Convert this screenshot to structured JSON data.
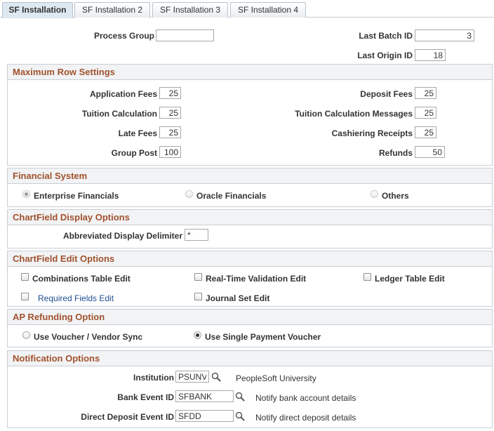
{
  "tabs": [
    {
      "label": "SF Installation",
      "active": true
    },
    {
      "label": "SF Installation 2",
      "active": false
    },
    {
      "label": "SF Installation 3",
      "active": false
    },
    {
      "label": "SF Installation 4",
      "active": false
    }
  ],
  "header": {
    "process_group_label": "Process Group",
    "process_group_value": "",
    "last_batch_id_label": "Last Batch ID",
    "last_batch_id_value": "3",
    "last_origin_id_label": "Last Origin ID",
    "last_origin_id_value": "18"
  },
  "max_row": {
    "title": "Maximum Row Settings",
    "application_fees_label": "Application Fees",
    "application_fees_value": "25",
    "tuition_calc_label": "Tuition Calculation",
    "tuition_calc_value": "25",
    "late_fees_label": "Late Fees",
    "late_fees_value": "25",
    "group_post_label": "Group Post",
    "group_post_value": "100",
    "deposit_fees_label": "Deposit Fees",
    "deposit_fees_value": "25",
    "tuition_calc_msgs_label": "Tuition Calculation Messages",
    "tuition_calc_msgs_value": "25",
    "cashiering_receipts_label": "Cashiering Receipts",
    "cashiering_receipts_value": "25",
    "refunds_label": "Refunds",
    "refunds_value": "50"
  },
  "financial_system": {
    "title": "Financial System",
    "options": [
      "Enterprise Financials",
      "Oracle Financials",
      "Others"
    ],
    "selected": "Enterprise Financials"
  },
  "chartfield_display": {
    "title": "ChartField Display Options",
    "delimiter_label": "Abbreviated Display Delimiter",
    "delimiter_value": "*"
  },
  "chartfield_edit": {
    "title": "ChartField Edit Options",
    "combinations_label": "Combinations Table Edit",
    "realtime_label": "Real-Time Validation Edit",
    "ledger_label": "Ledger Table Edit",
    "required_label": "Required Fields Edit",
    "journal_label": "Journal Set Edit"
  },
  "ap_refunding": {
    "title": "AP Refunding Option",
    "options": [
      "Use Voucher / Vendor Sync",
      "Use Single Payment Voucher"
    ],
    "selected": "Use Single Payment Voucher"
  },
  "notification": {
    "title": "Notification Options",
    "institution_label": "Institution",
    "institution_value": "PSUNV",
    "institution_desc": "PeopleSoft University",
    "bank_event_label": "Bank Event ID",
    "bank_event_value": "SFBANK",
    "bank_event_desc": "Notify bank account details",
    "direct_deposit_label": "Direct Deposit Event ID",
    "direct_deposit_value": "SFDD",
    "direct_deposit_desc": "Notify direct deposit details"
  },
  "icons": {
    "lookup": "magnifier-lookup-icon"
  },
  "colors": {
    "section_title": "#a0522d",
    "link": "#1d4f91",
    "tab_active": "#dde8f1"
  }
}
